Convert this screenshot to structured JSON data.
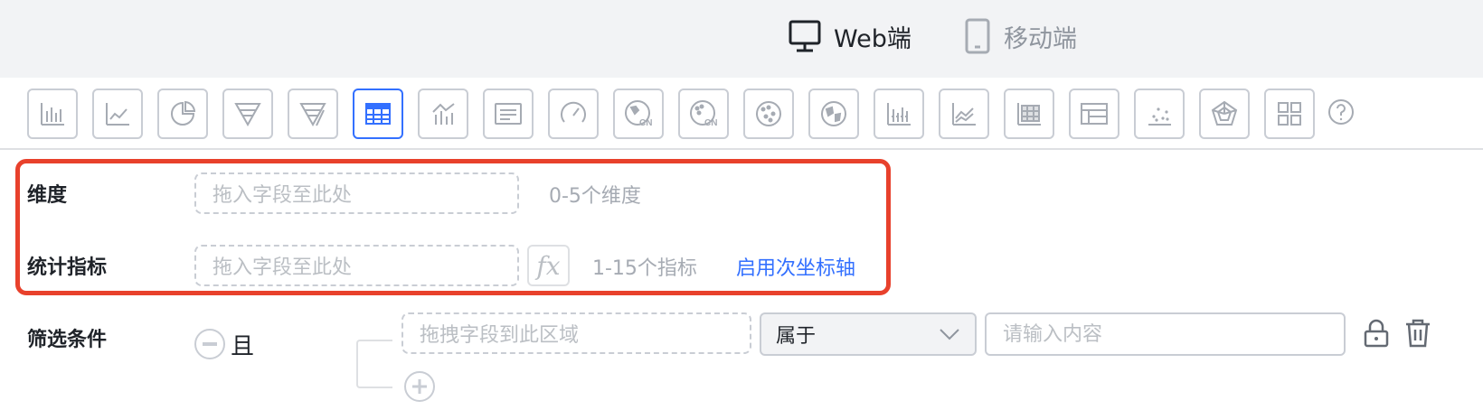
{
  "platform_tabs": [
    {
      "label": "Web端",
      "icon": "monitor-icon",
      "active": true
    },
    {
      "label": "移动端",
      "icon": "phone-icon",
      "active": false
    }
  ],
  "chart_types": [
    {
      "name": "bar-chart",
      "icon": "bar-chart-icon"
    },
    {
      "name": "line-chart",
      "icon": "line-chart-icon"
    },
    {
      "name": "pie-chart",
      "icon": "pie-chart-icon"
    },
    {
      "name": "funnel-chart",
      "icon": "funnel-chart-icon"
    },
    {
      "name": "funnel-slanted-chart",
      "icon": "funnel-slanted-icon"
    },
    {
      "name": "table-chart",
      "icon": "table-icon",
      "active": true
    },
    {
      "name": "bar-line-combo-chart",
      "icon": "bar-line-combo-icon"
    },
    {
      "name": "text-card",
      "icon": "text-card-icon"
    },
    {
      "name": "gauge-chart",
      "icon": "gauge-icon"
    },
    {
      "name": "china-map-chart",
      "icon": "china-map-icon",
      "badge": "CN"
    },
    {
      "name": "china-scatter-map-chart",
      "icon": "china-scatter-map-icon",
      "badge": "CN"
    },
    {
      "name": "world-scatter-map-chart",
      "icon": "world-scatter-map-icon"
    },
    {
      "name": "world-map-chart",
      "icon": "world-map-icon"
    },
    {
      "name": "stacked-bar-chart",
      "icon": "stacked-bar-icon"
    },
    {
      "name": "area-line-chart",
      "icon": "area-line-icon"
    },
    {
      "name": "heatmap-chart",
      "icon": "heatmap-icon"
    },
    {
      "name": "pivot-table-chart",
      "icon": "pivot-table-icon"
    },
    {
      "name": "scatter-chart",
      "icon": "scatter-icon"
    },
    {
      "name": "radar-chart",
      "icon": "radar-icon"
    },
    {
      "name": "dashboard-grid",
      "icon": "grid-icon"
    }
  ],
  "help_icon": "question-circle-icon",
  "dimension": {
    "label": "维度",
    "placeholder": "拖入字段至此处",
    "hint": "0-5个维度"
  },
  "metric": {
    "label": "统计指标",
    "placeholder": "拖入字段至此处",
    "fx_label": "fx",
    "hint": "1-15个指标",
    "secondary_axis_link": "启用次坐标轴"
  },
  "filter": {
    "label": "筛选条件",
    "logic_label": "且",
    "field_placeholder": "拖拽字段到此区域",
    "operator_value": "属于",
    "value_placeholder": "请输入内容"
  },
  "colors": {
    "accent": "#3370ff",
    "highlight": "#e8412c",
    "border": "#c9cdd4",
    "topbar_bg": "#f2f3f5"
  }
}
